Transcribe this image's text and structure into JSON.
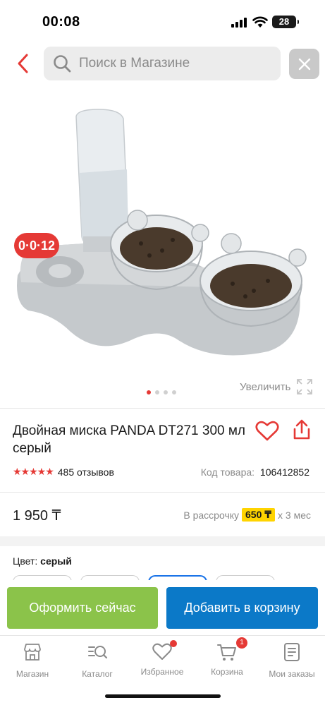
{
  "status_bar": {
    "time": "00:08",
    "battery": "28"
  },
  "search": {
    "placeholder": "Поиск в Магазине"
  },
  "product": {
    "promo_badge": "0·0·12",
    "zoom_label": "Увеличить",
    "title": "Двойная миска PANDA DT271 300 мл серый",
    "rating": "★★★★★",
    "rating_value": 5,
    "reviews": "485 отзывов",
    "code_label": "Код товара:",
    "code_value": "106412852",
    "price": "1 950 ₸",
    "installment_label": "В рассрочку",
    "installment_amount": "650 ₸",
    "installment_term": "x 3 мес",
    "color_label": "Цвет:",
    "color_value": "серый"
  },
  "gallery": {
    "total_images": 4,
    "active_index": 0
  },
  "actions": {
    "buy_now": "Оформить сейчас",
    "add_to_cart": "Добавить в корзину"
  },
  "tabs": [
    {
      "label": "Магазин",
      "icon": "shop-icon"
    },
    {
      "label": "Каталог",
      "icon": "catalog-search-icon"
    },
    {
      "label": "Избранное",
      "icon": "heart-icon"
    },
    {
      "label": "Корзина",
      "icon": "cart-icon",
      "badge": "1"
    },
    {
      "label": "Мои заказы",
      "icon": "orders-icon"
    }
  ],
  "colors": {
    "accent_red": "#e53935",
    "buy_green": "#8bc34a",
    "cart_blue": "#0b79c8",
    "installment_yellow": "#ffd400"
  }
}
